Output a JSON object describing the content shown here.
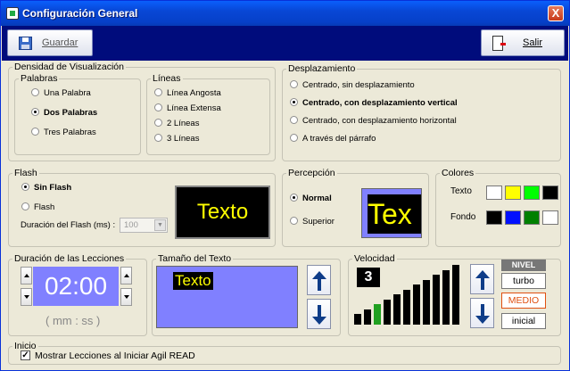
{
  "window": {
    "title": "Configuración General",
    "close_label": "X"
  },
  "toolbar": {
    "save_label": "Guardar",
    "exit_label": "Salir"
  },
  "display_density": {
    "legend": "Densidad de Visualización",
    "words": {
      "legend": "Palabras",
      "options": [
        "Una Palabra",
        "Dos Palabras",
        "Tres Palabras"
      ],
      "selected": 1
    },
    "lines": {
      "legend": "Líneas",
      "options": [
        "Línea Angosta",
        "Línea Extensa",
        "2 Líneas",
        "3 Líneas"
      ]
    }
  },
  "scrolling": {
    "legend": "Desplazamiento",
    "options": [
      "Centrado, sin desplazamiento",
      "Centrado, con desplazamiento vertical",
      "Centrado, con desplazamiento horizontal",
      "A través del párrafo"
    ],
    "selected": 1
  },
  "flash": {
    "legend": "Flash",
    "options": [
      "Sin Flash",
      "Flash"
    ],
    "selected": 0,
    "duration_label": "Duración del Flash  (ms)   :",
    "duration_value": "100",
    "preview_text": "Texto"
  },
  "perception": {
    "legend": "Percepción",
    "options": [
      "Normal",
      "Superior"
    ],
    "selected": 0,
    "preview_text": "Tex"
  },
  "colors": {
    "legend": "Colores",
    "text_label": "Texto",
    "background_label": "Fondo",
    "text_colors": [
      "#ffffff",
      "#ffff00",
      "#00ff00",
      "#000000"
    ],
    "background_colors": [
      "#000000",
      "#0010ff",
      "#008000",
      "#ffffff"
    ]
  },
  "lesson_duration": {
    "legend": "Duración de las Lecciones",
    "value": "02:00",
    "format_hint": "( mm : ss )"
  },
  "text_size": {
    "legend": "Tamaño del Texto",
    "preview_text": "Texto"
  },
  "speed": {
    "legend": "Velocidad",
    "value": "3",
    "bar_count": 11,
    "highlighted_bar": 2,
    "level": {
      "header": "NIVEL",
      "options": [
        "turbo",
        "MEDIO",
        "inicial"
      ],
      "selected": 1
    }
  },
  "startup": {
    "legend": "Inicio",
    "checkbox_label": "Mostrar Lecciones al Iniciar Agil READ",
    "checked": true
  },
  "accent_colors": {
    "title_bar": "#0847d6",
    "toolbar": "#000c7c",
    "preview_bg": "#8080ff",
    "preview_text": "#ffff00",
    "selected_level": "#e05010"
  }
}
